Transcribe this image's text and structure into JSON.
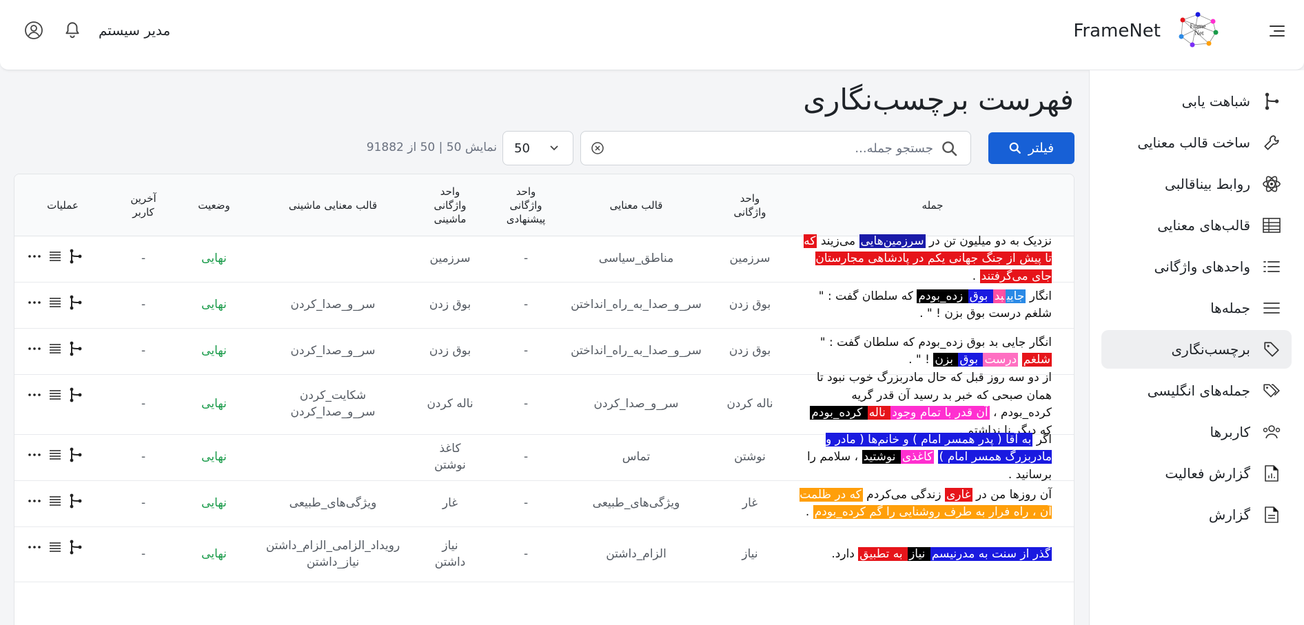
{
  "header": {
    "brand": "FrameNet",
    "user_name": "مدیر سیستم",
    "logo_text": "Frame Net"
  },
  "sidebar": {
    "items": [
      {
        "label": "شباهت یابی",
        "icon": "branch-icon"
      },
      {
        "label": "ساخت قالب معنایی",
        "icon": "wrench-icon"
      },
      {
        "label": "روابط بیناقالبی",
        "icon": "atom-icon"
      },
      {
        "label": "قالب‌های معنایی",
        "icon": "table-icon"
      },
      {
        "label": "واحدهای واژگانی",
        "icon": "list-icon"
      },
      {
        "label": "جمله‌ها",
        "icon": "lines-icon"
      },
      {
        "label": "برچسب‌نگاری",
        "icon": "tag-icon",
        "active": true
      },
      {
        "label": "جمله‌های انگلیسی",
        "icon": "tags-icon"
      },
      {
        "label": "کاربرها",
        "icon": "users-icon"
      },
      {
        "label": "گزارش فعالیت",
        "icon": "file-chart-icon"
      },
      {
        "label": "گزارش",
        "icon": "file-icon"
      }
    ]
  },
  "main": {
    "title": "فهرست برچسب‌نگاری",
    "filter_label": "فیلتر",
    "search_placeholder": "جستجو جمله...",
    "page_size": "50",
    "count_text": "نمایش 50 | 50 از 91882"
  },
  "table": {
    "headers": {
      "sentence": "جمله",
      "lu": [
        "واحد",
        "واژگانی"
      ],
      "frame": "قالب معنایی",
      "suggested_lu": [
        "واحد",
        "واژگانی",
        "پیشنهادی"
      ],
      "machine_lu": [
        "واحد",
        "واژگانی",
        "ماشینی"
      ],
      "machine_frame": "قالب معنایی ماشینی",
      "status": "وضعیت",
      "last_user": [
        "آخرین",
        "کاربر"
      ],
      "ops": "عملیات"
    },
    "rows": [
      {
        "sentence": [
          {
            "t": "نزدیک به دو میلیون تن در "
          },
          {
            "t": "سرزمین‌هایی",
            "bg": "#1a1aa8",
            "fg": "#fff"
          },
          {
            "t": " می‌زیند "
          },
          {
            "t": "که تا پیش از جنگ جهانی یکم در پادشاهی مجارستان جای می‌گرفتند",
            "bg": "#e6141a",
            "fg": "#fff"
          },
          {
            "t": " ."
          }
        ],
        "lu": "سرزمین",
        "frame": "مناطق_سیاسی",
        "suggested": "-",
        "machine_lu": [
          "سرزمین"
        ],
        "machine_frame": [
          ""
        ],
        "status": "نهایی",
        "last_user": "-"
      },
      {
        "sentence": [
          {
            "t": "انگار "
          },
          {
            "t": "جایی",
            "bg": "#2b8ae6",
            "fg": "#fff"
          },
          {
            "t": "بد",
            "bg": "#ff4fa3",
            "fg": "#fff"
          },
          {
            "t": " بوق",
            "bg": "#1a1ae0",
            "fg": "#fff"
          },
          {
            "t": " زده_بودم",
            "bg": "#000",
            "fg": "#fff"
          },
          {
            "t": " که سلطان گفت : \" شلغم درست بوق بزن ! \" ."
          }
        ],
        "lu": "بوق زدن",
        "frame": "سر_و_صدا_به_راه_انداختن",
        "suggested": "-",
        "machine_lu": [
          "بوق زدن"
        ],
        "machine_frame": [
          "سر_و_صدا_کردن"
        ],
        "status": "نهایی",
        "last_user": "-"
      },
      {
        "sentence": [
          {
            "t": "انگار جایی بد بوق زده_بودم که سلطان گفت : \" "
          },
          {
            "t": "شلغم",
            "bg": "#e6141a",
            "fg": "#fff"
          },
          {
            "t": " "
          },
          {
            "t": "درست",
            "bg": "#ff6fc2",
            "fg": "#fff"
          },
          {
            "t": " بوق",
            "bg": "#1a1ae0",
            "fg": "#fff"
          },
          {
            "t": " بزن",
            "bg": "#000",
            "fg": "#fff"
          },
          {
            "t": " ! \" ."
          }
        ],
        "lu": "بوق زدن",
        "frame": "سر_و_صدا_به_راه_انداختن",
        "suggested": "-",
        "machine_lu": [
          "بوق زدن"
        ],
        "machine_frame": [
          "سر_و_صدا_کردن"
        ],
        "status": "نهایی",
        "last_user": "-"
      },
      {
        "sentence": [
          {
            "t": "از دو سه روز قبل که حال مادربزرگ خوب نبود تا همان صبحی که خبر بد رسید آن قدر گریه کرده_بودم ، "
          },
          {
            "t": "آن قدر با تمام وجود",
            "bg": "#ff2fd0",
            "fg": "#fff"
          },
          {
            "t": " ناله",
            "bg": "#e6141a",
            "fg": "#fff"
          },
          {
            "t": " کرده_بودم",
            "bg": "#000",
            "fg": "#fff"
          },
          {
            "t": " که دیگر نا نداشتم ."
          }
        ],
        "lu": "ناله کردن",
        "frame": "سر_و_صدا_کردن",
        "suggested": "-",
        "machine_lu": [
          "ناله کردن"
        ],
        "machine_frame": [
          "شکایت_کردن",
          "سر_و_صدا_کردن"
        ],
        "status": "نهایی",
        "last_user": "-"
      },
      {
        "sentence": [
          {
            "t": "اگر "
          },
          {
            "t": "به آقا ( پدر همسر امام ) و خانم‌ها ( مادر و مادربزرگ همسر امام )",
            "bg": "#1a1ae0",
            "fg": "#fff"
          },
          {
            "t": " "
          },
          {
            "t": "کاغذی",
            "bg": "#ff2fd0",
            "fg": "#fff"
          },
          {
            "t": " نوشتید",
            "bg": "#000",
            "fg": "#fff"
          },
          {
            "t": " ، سلامم را برسانید ."
          }
        ],
        "lu": "نوشتن",
        "frame": "تماس",
        "suggested": "-",
        "machine_lu": [
          "کاغذ",
          "نوشتن"
        ],
        "machine_frame": [
          ""
        ],
        "status": "نهایی",
        "last_user": "-"
      },
      {
        "sentence": [
          {
            "t": "آن روزها من در "
          },
          {
            "t": "غاری",
            "bg": "#e6141a",
            "fg": "#fff"
          },
          {
            "t": " زندگی می‌کردم "
          },
          {
            "t": "که در ظلمت آن ، راه فرار به طرف روشنایی را گم کرده_بودم",
            "bg": "#ff9f0a",
            "fg": "#fff"
          },
          {
            "t": " ."
          }
        ],
        "lu": "غار",
        "frame": "ویژگی‌های_طبیعی",
        "suggested": "-",
        "machine_lu": [
          "غار"
        ],
        "machine_frame": [
          "ویژگی‌های_طبیعی"
        ],
        "status": "نهایی",
        "last_user": "-"
      },
      {
        "sentence": [
          {
            "t": "گذر از سنت به مدرنیسم",
            "bg": "#1a1ae0",
            "fg": "#fff"
          },
          {
            "t": " نیاز",
            "bg": "#000",
            "fg": "#fff"
          },
          {
            "t": " به تطبیق",
            "bg": "#e6141a",
            "fg": "#fff"
          },
          {
            "t": " دارد."
          }
        ],
        "lu": "نیاز",
        "frame": "الزام_داشتن",
        "suggested": "-",
        "machine_lu": [
          "نیاز",
          "داشتن"
        ],
        "machine_frame": [
          "رویداد_الزامی_الزام_داشتن",
          "نیاز_داشتن"
        ],
        "status": "نهایی",
        "last_user": "-"
      }
    ]
  },
  "colors": {
    "primary": "#1760d6",
    "status_final": "#1a9b4a",
    "active_nav_bg": "#eeeff1"
  }
}
